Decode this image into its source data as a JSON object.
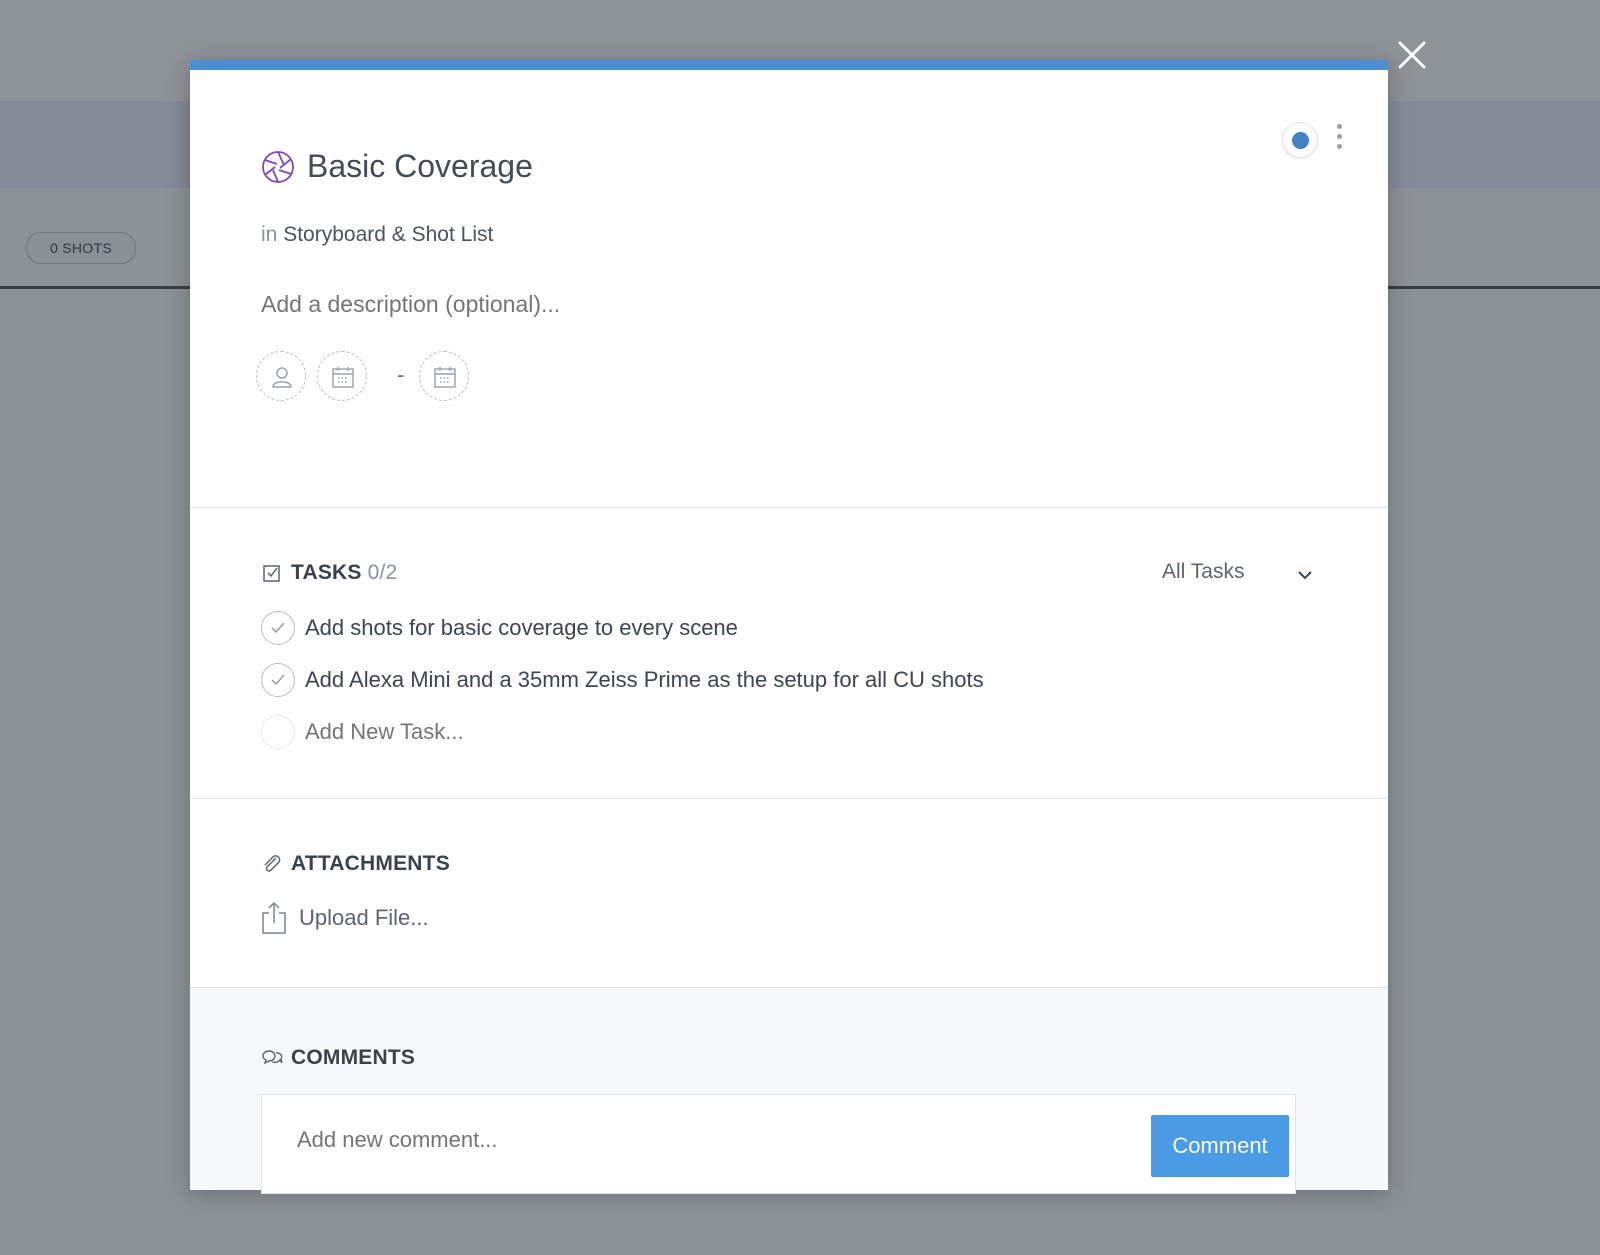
{
  "background": {
    "shots_badge": "0 SHOTS"
  },
  "modal": {
    "accent_color": "#4a8fd3",
    "title": "Basic Coverage",
    "title_icon": "aperture-icon",
    "in_prefix": "in",
    "project": "Storyboard & Shot List",
    "description_placeholder": "Add a description (optional)...",
    "date_separator": "-",
    "status_color": "#3f82c6"
  },
  "tasks": {
    "heading": "TASKS",
    "count": "0/2",
    "filter": "All Tasks",
    "items": [
      {
        "text": "Add shots for basic coverage to every scene",
        "done": false
      },
      {
        "text": "Add Alexa Mini and a 35mm Zeiss Prime as the setup for all CU shots",
        "done": false
      }
    ],
    "new_task_placeholder": "Add New Task..."
  },
  "attachments": {
    "heading": "ATTACHMENTS",
    "upload_label": "Upload File..."
  },
  "comments": {
    "heading": "COMMENTS",
    "placeholder": "Add new comment...",
    "button_label": "Comment",
    "button_color": "#4a9be6"
  }
}
